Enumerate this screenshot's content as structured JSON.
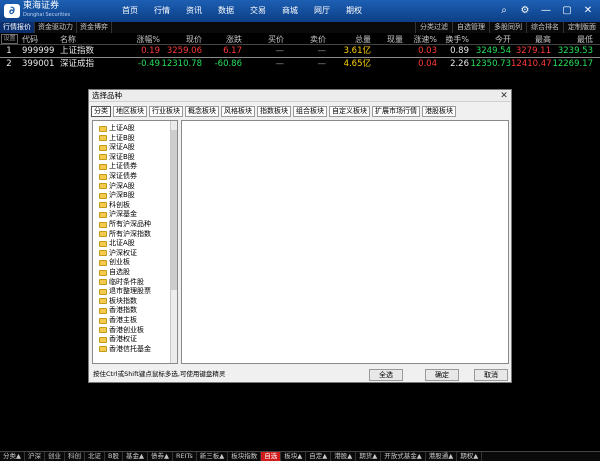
{
  "app": {
    "logo_text": "東海证券",
    "logo_sub": "Donghai Securities",
    "nav": [
      "首页",
      "行情",
      "资讯",
      "数据",
      "交易",
      "商城",
      "网厅",
      "期权"
    ],
    "window_controls": [
      "search-icon",
      "gear-icon",
      "minimize-icon",
      "maximize-icon",
      "close-icon"
    ]
  },
  "subtabs": [
    "行情报价",
    "资金驱动力",
    "资金博弈"
  ],
  "right_buttons": [
    "分类过滤",
    "自选管理",
    "多股同列",
    "综合排名",
    "定制版面"
  ],
  "table": {
    "headers": [
      "代码",
      "名称",
      "涨幅%",
      "现价",
      "涨跌",
      "买价",
      "卖价",
      "总量",
      "现量",
      "涨速%",
      "换手%",
      "今开",
      "最高",
      "最低"
    ],
    "rows": [
      {
        "idx": "1",
        "code": "999999",
        "name": "上证指数",
        "pct": "0.19",
        "price": "3259.06",
        "chg": "6.17",
        "buy": "—",
        "sell": "—",
        "vol": "3.61亿",
        "cur": "",
        "spd": "0.03",
        "turn": "0.89",
        "open": "3249.54",
        "high": "3279.11",
        "low": "3239.53"
      },
      {
        "idx": "2",
        "code": "399001",
        "name": "深证成指",
        "pct": "-0.49",
        "price": "12310.78",
        "chg": "-60.86",
        "buy": "—",
        "sell": "—",
        "vol": "4.65亿",
        "cur": "",
        "spd": "0.04",
        "turn": "2.26",
        "open": "12350.73",
        "high": "12410.47",
        "low": "12269.17"
      }
    ]
  },
  "dialog": {
    "title": "选择品种",
    "tabs": [
      "分类",
      "地区板块",
      "行业板块",
      "概念板块",
      "风格板块",
      "指数板块",
      "组合板块",
      "自定义板块",
      "扩展市场行情",
      "港股板块"
    ],
    "tree": [
      "上证A股",
      "上证B股",
      "深证A股",
      "深证B股",
      "上证债券",
      "深证债券",
      "沪深A股",
      "沪深B股",
      "科创板",
      "沪深基金",
      "所有沪深品种",
      "所有沪深指数",
      "北证A股",
      "沪深权证",
      "创业板",
      "自选股",
      "临时条件股",
      "退市整理股票",
      "板块指数",
      "香港指数",
      "香港主板",
      "香港创业板",
      "香港权证",
      "香港信托基金"
    ],
    "hint": "按住Ctrl或Shift键点鼠标多选,可使用键盘精灵",
    "buttons": {
      "select_all": "全选",
      "ok": "确定",
      "cancel": "取消"
    }
  },
  "bottom_tabs": [
    "分类▲",
    "沪深",
    "创业",
    "科创",
    "北证",
    "B股",
    "基金▲",
    "债券▲",
    "REITs",
    "新三板▲",
    "板块指数",
    "自选",
    "板块▲",
    "自定▲",
    "港股▲",
    "期货▲",
    "开放式基金▲",
    "港股通▲",
    "期权▲"
  ],
  "colors": {
    "up": "#ff3a3a",
    "down": "#27e05a",
    "volume": "#ffd200",
    "nav_bg": "#1d5fb3",
    "active_bottom_tab": "#d11c1c"
  }
}
